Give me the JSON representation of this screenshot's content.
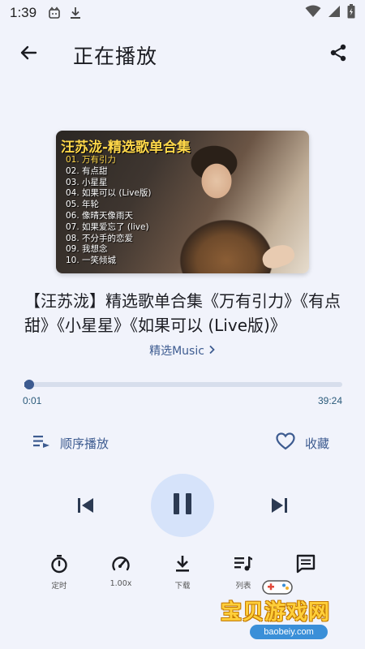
{
  "status_bar": {
    "time": "1:39",
    "icons": [
      "cat-notification-icon",
      "download-icon",
      "wifi-icon",
      "signal-icon",
      "battery-icon"
    ]
  },
  "app_bar": {
    "title": "正在播放",
    "back_icon": "arrow-left-icon",
    "share_icon": "share-icon"
  },
  "cover": {
    "title": "汪苏泷-精选歌单合集",
    "tracks": [
      "01. 万有引力",
      "02. 有点甜",
      "03. 小星星",
      "04. 如果可以 (Live版)",
      "05. 年轮",
      "06. 像晴天像雨天",
      "07. 如果爱忘了 (live)",
      "08. 不分手的恋爱",
      "09. 我想念",
      "10. 一笑倾城"
    ]
  },
  "song": {
    "title": "【汪苏泷】精选歌单合集《万有引力》《有点甜》《小星星》《如果可以 (Live版)》",
    "album_link": "精选Music"
  },
  "progress": {
    "current": "0:01",
    "total": "39:24",
    "fraction": 0.0004
  },
  "controls": {
    "mode_label": "顺序播放",
    "favorite_label": "收藏",
    "play_state": "playing"
  },
  "tools": [
    {
      "name": "timer",
      "label": "定时",
      "icon": "stopwatch-icon"
    },
    {
      "name": "speed",
      "label": "1.00x",
      "icon": "speedometer-icon"
    },
    {
      "name": "download",
      "label": "下载",
      "icon": "download-icon"
    },
    {
      "name": "playlist",
      "label": "列表",
      "icon": "playlist-icon"
    },
    {
      "name": "comments",
      "label": "",
      "icon": "comment-icon"
    }
  ],
  "watermark": {
    "text": "宝贝游戏网",
    "url": "baobeiy.com"
  },
  "colors": {
    "background": "#f1f3fb",
    "accent": "#3d5b90",
    "play_button_bg": "#d6e3fa",
    "cover_title": "#ffd84a"
  }
}
